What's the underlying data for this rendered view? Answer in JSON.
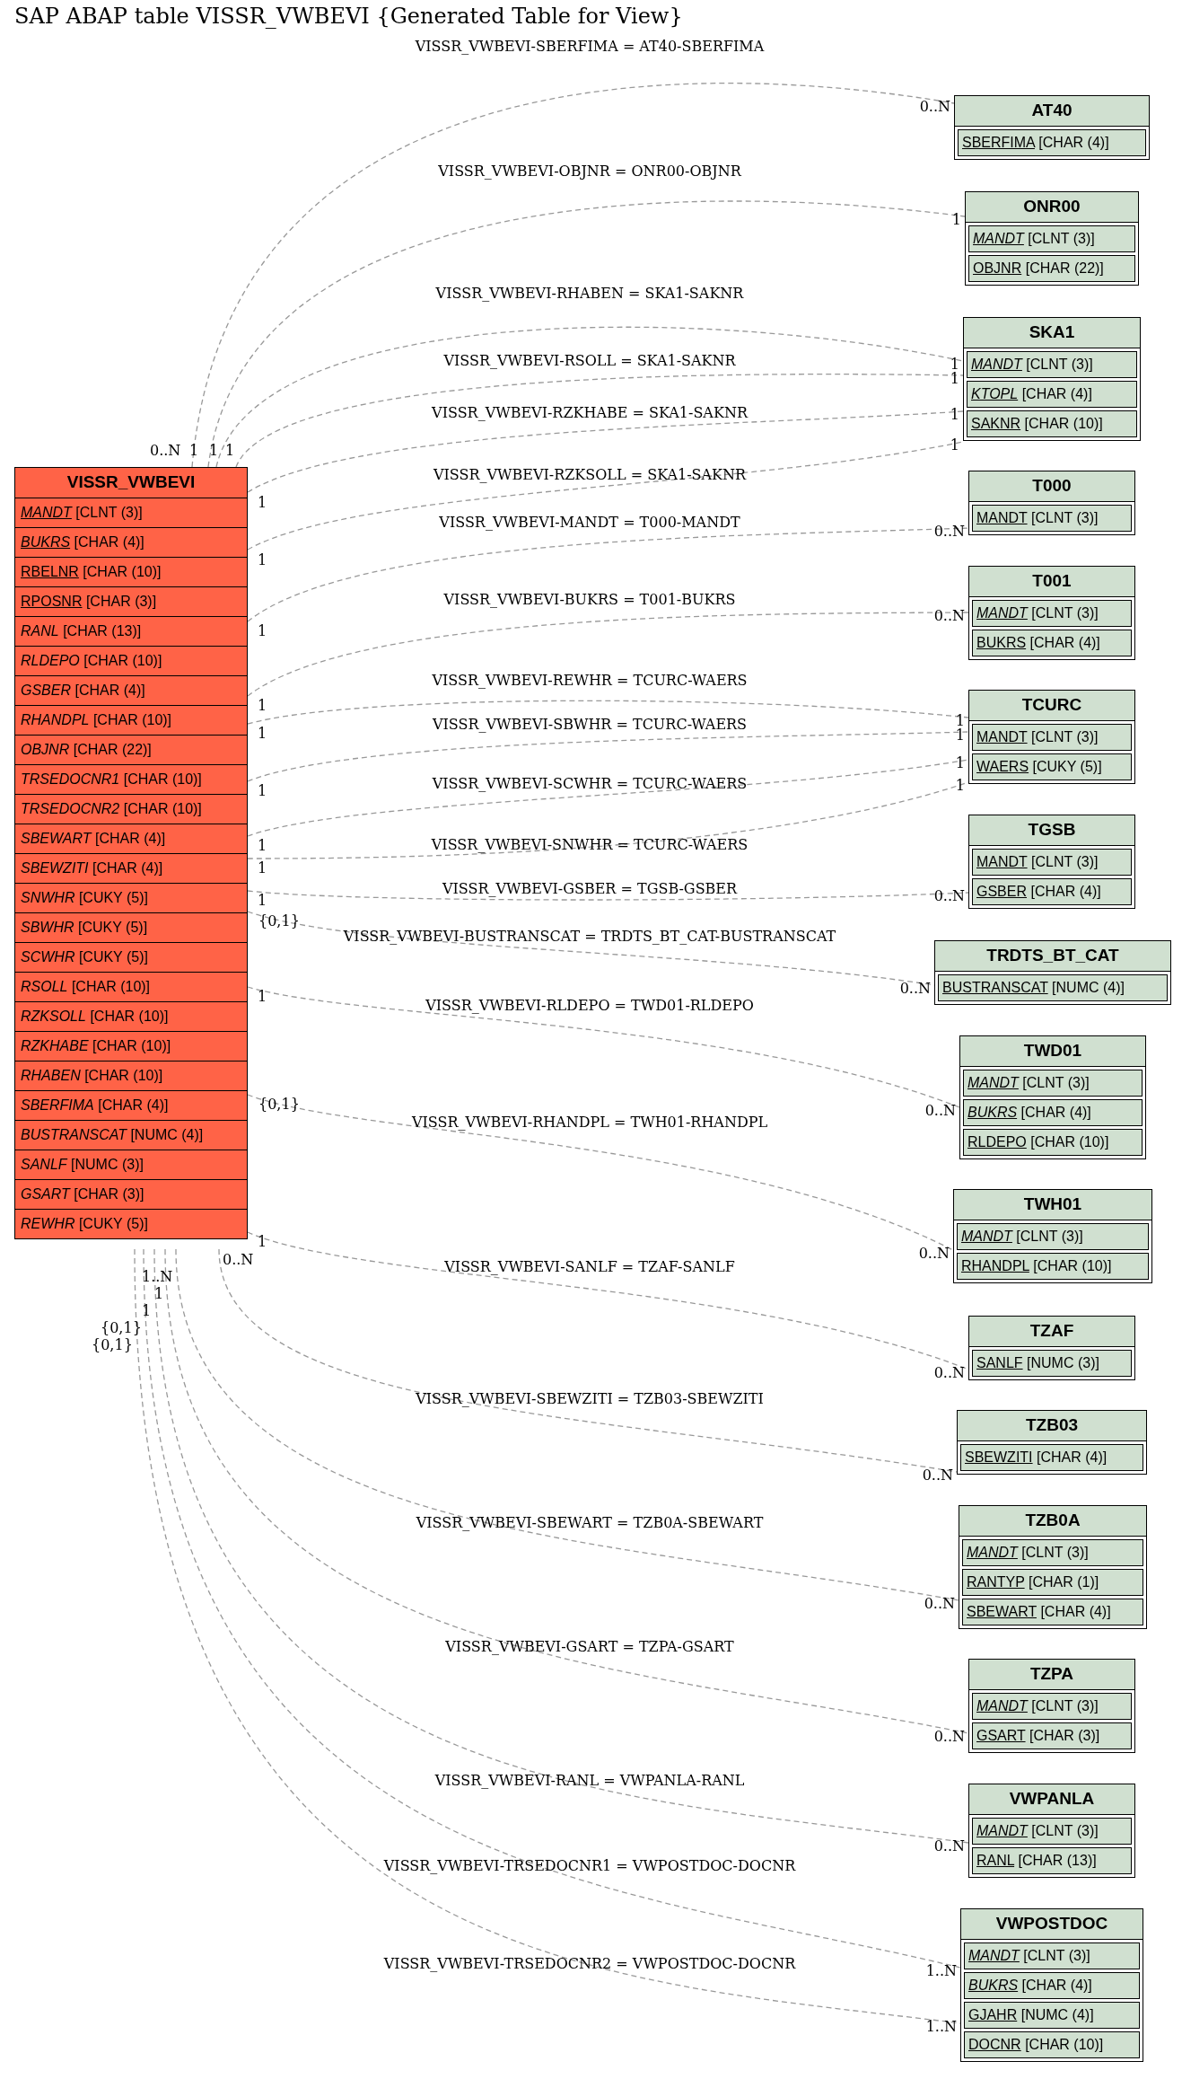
{
  "title": "SAP ABAP table VISSR_VWBEVI {Generated Table for View}",
  "main_table": {
    "name": "VISSR_VWBEVI",
    "fields": [
      {
        "name": "MANDT",
        "type": "[CLNT (3)]",
        "key": true,
        "italic": true
      },
      {
        "name": "BUKRS",
        "type": "[CHAR (4)]",
        "key": true,
        "italic": true
      },
      {
        "name": "RBELNR",
        "type": "[CHAR (10)]",
        "key": true,
        "italic": false
      },
      {
        "name": "RPOSNR",
        "type": "[CHAR (3)]",
        "key": true,
        "italic": false
      },
      {
        "name": "RANL",
        "type": "[CHAR (13)]",
        "key": false,
        "italic": true
      },
      {
        "name": "RLDEPO",
        "type": "[CHAR (10)]",
        "key": false,
        "italic": true
      },
      {
        "name": "GSBER",
        "type": "[CHAR (4)]",
        "key": false,
        "italic": true
      },
      {
        "name": "RHANDPL",
        "type": "[CHAR (10)]",
        "key": false,
        "italic": true
      },
      {
        "name": "OBJNR",
        "type": "[CHAR (22)]",
        "key": false,
        "italic": true
      },
      {
        "name": "TRSEDOCNR1",
        "type": "[CHAR (10)]",
        "key": false,
        "italic": true
      },
      {
        "name": "TRSEDOCNR2",
        "type": "[CHAR (10)]",
        "key": false,
        "italic": true
      },
      {
        "name": "SBEWART",
        "type": "[CHAR (4)]",
        "key": false,
        "italic": true
      },
      {
        "name": "SBEWZITI",
        "type": "[CHAR (4)]",
        "key": false,
        "italic": true
      },
      {
        "name": "SNWHR",
        "type": "[CUKY (5)]",
        "key": false,
        "italic": true
      },
      {
        "name": "SBWHR",
        "type": "[CUKY (5)]",
        "key": false,
        "italic": true
      },
      {
        "name": "SCWHR",
        "type": "[CUKY (5)]",
        "key": false,
        "italic": true
      },
      {
        "name": "RSOLL",
        "type": "[CHAR (10)]",
        "key": false,
        "italic": true
      },
      {
        "name": "RZKSOLL",
        "type": "[CHAR (10)]",
        "key": false,
        "italic": true
      },
      {
        "name": "RZKHABE",
        "type": "[CHAR (10)]",
        "key": false,
        "italic": true
      },
      {
        "name": "RHABEN",
        "type": "[CHAR (10)]",
        "key": false,
        "italic": true
      },
      {
        "name": "SBERFIMA",
        "type": "[CHAR (4)]",
        "key": false,
        "italic": true
      },
      {
        "name": "BUSTRANSCAT",
        "type": "[NUMC (4)]",
        "key": false,
        "italic": true
      },
      {
        "name": "SANLF",
        "type": "[NUMC (3)]",
        "key": false,
        "italic": true
      },
      {
        "name": "GSART",
        "type": "[CHAR (3)]",
        "key": false,
        "italic": true
      },
      {
        "name": "REWHR",
        "type": "[CUKY (5)]",
        "key": false,
        "italic": true
      }
    ]
  },
  "tables": [
    {
      "name": "AT40",
      "fields": [
        {
          "name": "SBERFIMA",
          "type": "[CHAR (4)]",
          "key": true,
          "italic": false
        }
      ]
    },
    {
      "name": "ONR00",
      "fields": [
        {
          "name": "MANDT",
          "type": "[CLNT (3)]",
          "key": true,
          "italic": true
        },
        {
          "name": "OBJNR",
          "type": "[CHAR (22)]",
          "key": true,
          "italic": false
        }
      ]
    },
    {
      "name": "SKA1",
      "fields": [
        {
          "name": "MANDT",
          "type": "[CLNT (3)]",
          "key": true,
          "italic": true
        },
        {
          "name": "KTOPL",
          "type": "[CHAR (4)]",
          "key": true,
          "italic": true
        },
        {
          "name": "SAKNR",
          "type": "[CHAR (10)]",
          "key": true,
          "italic": false
        }
      ]
    },
    {
      "name": "T000",
      "fields": [
        {
          "name": "MANDT",
          "type": "[CLNT (3)]",
          "key": true,
          "italic": false
        }
      ]
    },
    {
      "name": "T001",
      "fields": [
        {
          "name": "MANDT",
          "type": "[CLNT (3)]",
          "key": true,
          "italic": true
        },
        {
          "name": "BUKRS",
          "type": "[CHAR (4)]",
          "key": true,
          "italic": false
        }
      ]
    },
    {
      "name": "TCURC",
      "fields": [
        {
          "name": "MANDT",
          "type": "[CLNT (3)]",
          "key": true,
          "italic": false
        },
        {
          "name": "WAERS",
          "type": "[CUKY (5)]",
          "key": true,
          "italic": false
        }
      ]
    },
    {
      "name": "TGSB",
      "fields": [
        {
          "name": "MANDT",
          "type": "[CLNT (3)]",
          "key": true,
          "italic": false
        },
        {
          "name": "GSBER",
          "type": "[CHAR (4)]",
          "key": true,
          "italic": false
        }
      ]
    },
    {
      "name": "TRDTS_BT_CAT",
      "fields": [
        {
          "name": "BUSTRANSCAT",
          "type": "[NUMC (4)]",
          "key": true,
          "italic": false
        }
      ]
    },
    {
      "name": "TWD01",
      "fields": [
        {
          "name": "MANDT",
          "type": "[CLNT (3)]",
          "key": true,
          "italic": true
        },
        {
          "name": "BUKRS",
          "type": "[CHAR (4)]",
          "key": true,
          "italic": true
        },
        {
          "name": "RLDEPO",
          "type": "[CHAR (10)]",
          "key": true,
          "italic": false
        }
      ]
    },
    {
      "name": "TWH01",
      "fields": [
        {
          "name": "MANDT",
          "type": "[CLNT (3)]",
          "key": true,
          "italic": true
        },
        {
          "name": "RHANDPL",
          "type": "[CHAR (10)]",
          "key": true,
          "italic": false
        }
      ]
    },
    {
      "name": "TZAF",
      "fields": [
        {
          "name": "SANLF",
          "type": "[NUMC (3)]",
          "key": true,
          "italic": false
        }
      ]
    },
    {
      "name": "TZB03",
      "fields": [
        {
          "name": "SBEWZITI",
          "type": "[CHAR (4)]",
          "key": true,
          "italic": false
        }
      ]
    },
    {
      "name": "TZB0A",
      "fields": [
        {
          "name": "MANDT",
          "type": "[CLNT (3)]",
          "key": true,
          "italic": true
        },
        {
          "name": "RANTYP",
          "type": "[CHAR (1)]",
          "key": true,
          "italic": false
        },
        {
          "name": "SBEWART",
          "type": "[CHAR (4)]",
          "key": true,
          "italic": false
        }
      ]
    },
    {
      "name": "TZPA",
      "fields": [
        {
          "name": "MANDT",
          "type": "[CLNT (3)]",
          "key": true,
          "italic": true
        },
        {
          "name": "GSART",
          "type": "[CHAR (3)]",
          "key": true,
          "italic": false
        }
      ]
    },
    {
      "name": "VWPANLA",
      "fields": [
        {
          "name": "MANDT",
          "type": "[CLNT (3)]",
          "key": true,
          "italic": true
        },
        {
          "name": "RANL",
          "type": "[CHAR (13)]",
          "key": true,
          "italic": false
        }
      ]
    },
    {
      "name": "VWPOSTDOC",
      "fields": [
        {
          "name": "MANDT",
          "type": "[CLNT (3)]",
          "key": true,
          "italic": true
        },
        {
          "name": "BUKRS",
          "type": "[CHAR (4)]",
          "key": true,
          "italic": true
        },
        {
          "name": "GJAHR",
          "type": "[NUMC (4)]",
          "key": true,
          "italic": false
        },
        {
          "name": "DOCNR",
          "type": "[CHAR (10)]",
          "key": true,
          "italic": false
        }
      ]
    }
  ],
  "relations": [
    {
      "label": "VISSR_VWBEVI-SBERFIMA = AT40-SBERFIMA",
      "from_cardinality": "0..N",
      "to_cardinality": "0..N"
    },
    {
      "label": "VISSR_VWBEVI-OBJNR = ONR00-OBJNR",
      "from_cardinality": "1",
      "to_cardinality": "1"
    },
    {
      "label": "VISSR_VWBEVI-RHABEN = SKA1-SAKNR",
      "from_cardinality": "1",
      "to_cardinality": "1"
    },
    {
      "label": "VISSR_VWBEVI-RSOLL = SKA1-SAKNR",
      "from_cardinality": "1",
      "to_cardinality": "1"
    },
    {
      "label": "VISSR_VWBEVI-RZKHABE = SKA1-SAKNR",
      "from_cardinality": "1",
      "to_cardinality": "1"
    },
    {
      "label": "VISSR_VWBEVI-RZKSOLL = SKA1-SAKNR",
      "from_cardinality": "1",
      "to_cardinality": "1"
    },
    {
      "label": "VISSR_VWBEVI-MANDT = T000-MANDT",
      "from_cardinality": "1",
      "to_cardinality": "0..N"
    },
    {
      "label": "VISSR_VWBEVI-BUKRS = T001-BUKRS",
      "from_cardinality": "1",
      "to_cardinality": "0..N"
    },
    {
      "label": "VISSR_VWBEVI-REWHR = TCURC-WAERS",
      "from_cardinality": "1",
      "to_cardinality": "1"
    },
    {
      "label": "VISSR_VWBEVI-SBWHR = TCURC-WAERS",
      "from_cardinality": "1",
      "to_cardinality": "1"
    },
    {
      "label": "VISSR_VWBEVI-SCWHR = TCURC-WAERS",
      "from_cardinality": "1",
      "to_cardinality": "1"
    },
    {
      "label": "VISSR_VWBEVI-SNWHR = TCURC-WAERS",
      "from_cardinality": "1",
      "to_cardinality": "1"
    },
    {
      "label": "VISSR_VWBEVI-GSBER = TGSB-GSBER",
      "from_cardinality": "1",
      "to_cardinality": "0..N"
    },
    {
      "label": "VISSR_VWBEVI-BUSTRANSCAT = TRDTS_BT_CAT-BUSTRANSCAT",
      "from_cardinality": "{0,1}",
      "to_cardinality": "0..N"
    },
    {
      "label": "VISSR_VWBEVI-RLDEPO = TWD01-RLDEPO",
      "from_cardinality": "1",
      "to_cardinality": "0..N"
    },
    {
      "label": "VISSR_VWBEVI-RHANDPL = TWH01-RHANDPL",
      "from_cardinality": "{0,1}",
      "to_cardinality": "0..N"
    },
    {
      "label": "VISSR_VWBEVI-SANLF = TZAF-SANLF",
      "from_cardinality": "1",
      "to_cardinality": "0..N"
    },
    {
      "label": "VISSR_VWBEVI-SBEWZITI = TZB03-SBEWZITI",
      "from_cardinality": "0..N",
      "to_cardinality": "0..N"
    },
    {
      "label": "VISSR_VWBEVI-SBEWART = TZB0A-SBEWART",
      "from_cardinality": "1..N",
      "to_cardinality": "0..N"
    },
    {
      "label": "VISSR_VWBEVI-GSART = TZPA-GSART",
      "from_cardinality": "1",
      "to_cardinality": "0..N"
    },
    {
      "label": "VISSR_VWBEVI-RANL = VWPANLA-RANL",
      "from_cardinality": "1",
      "to_cardinality": "0..N"
    },
    {
      "label": "VISSR_VWBEVI-TRSEDOCNR1 = VWPOSTDOC-DOCNR",
      "from_cardinality": "{0,1}",
      "to_cardinality": "1..N"
    },
    {
      "label": "VISSR_VWBEVI-TRSEDOCNR2 = VWPOSTDOC-DOCNR",
      "from_cardinality": "{0,1}",
      "to_cardinality": "1..N"
    }
  ]
}
